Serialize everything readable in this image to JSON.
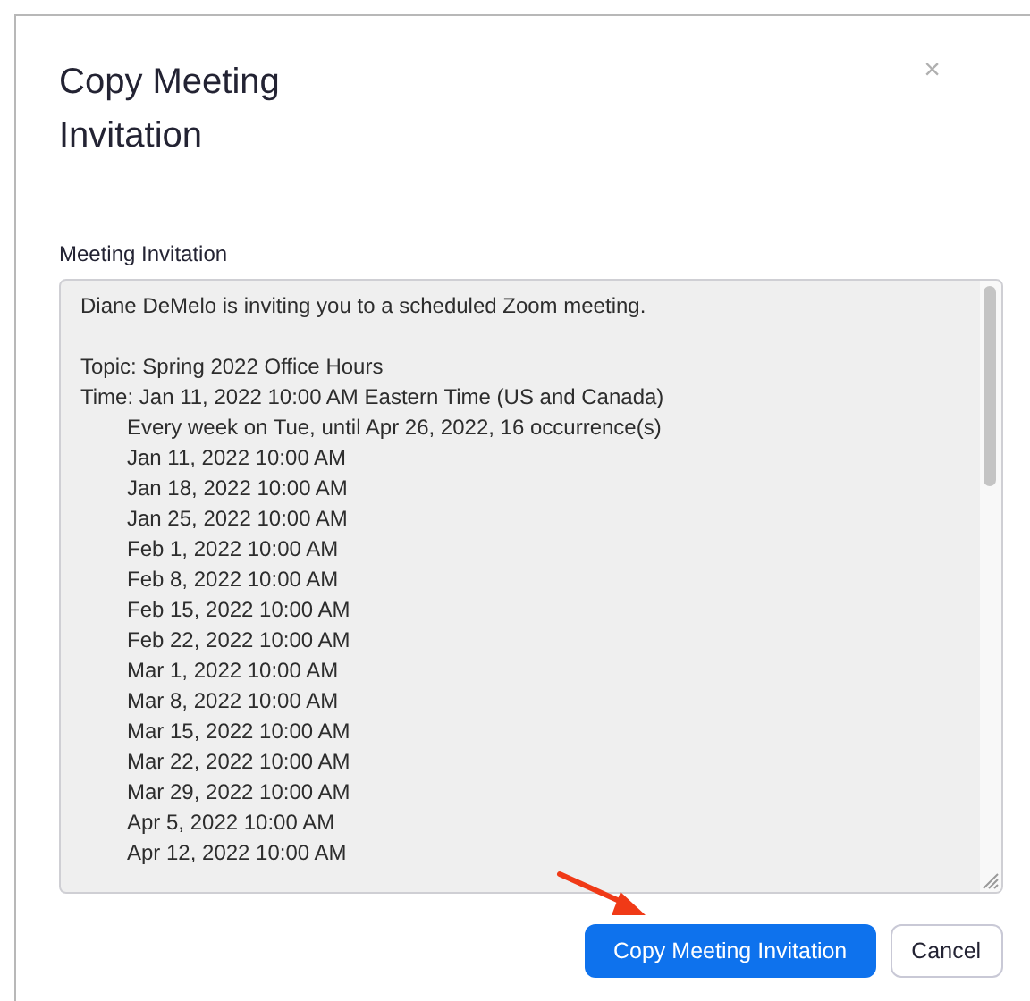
{
  "dialog": {
    "title": "Copy Meeting Invitation",
    "close": "×"
  },
  "invitation": {
    "label": "Meeting Invitation",
    "message": "Diane DeMelo is inviting you to a scheduled Zoom meeting.",
    "topic": "Topic: Spring 2022 Office Hours",
    "time": "Time: Jan 11, 2022 10:00 AM Eastern Time (US and Canada)",
    "recurrence": "Every week on Tue, until Apr 26, 2022, 16 occurrence(s)",
    "occurrences": [
      "Jan 11, 2022 10:00 AM",
      "Jan 18, 2022 10:00 AM",
      "Jan 25, 2022 10:00 AM",
      "Feb 1, 2022 10:00 AM",
      "Feb 8, 2022 10:00 AM",
      "Feb 15, 2022 10:00 AM",
      "Feb 22, 2022 10:00 AM",
      "Mar 1, 2022 10:00 AM",
      "Mar 8, 2022 10:00 AM",
      "Mar 15, 2022 10:00 AM",
      "Mar 22, 2022 10:00 AM",
      "Mar 29, 2022 10:00 AM",
      "Apr 5, 2022 10:00 AM",
      "Apr 12, 2022 10:00 AM"
    ]
  },
  "buttons": [
    {
      "label": "Copy Meeting Invitation",
      "kind": "primary"
    },
    {
      "label": "Cancel",
      "kind": "secondary"
    }
  ]
}
